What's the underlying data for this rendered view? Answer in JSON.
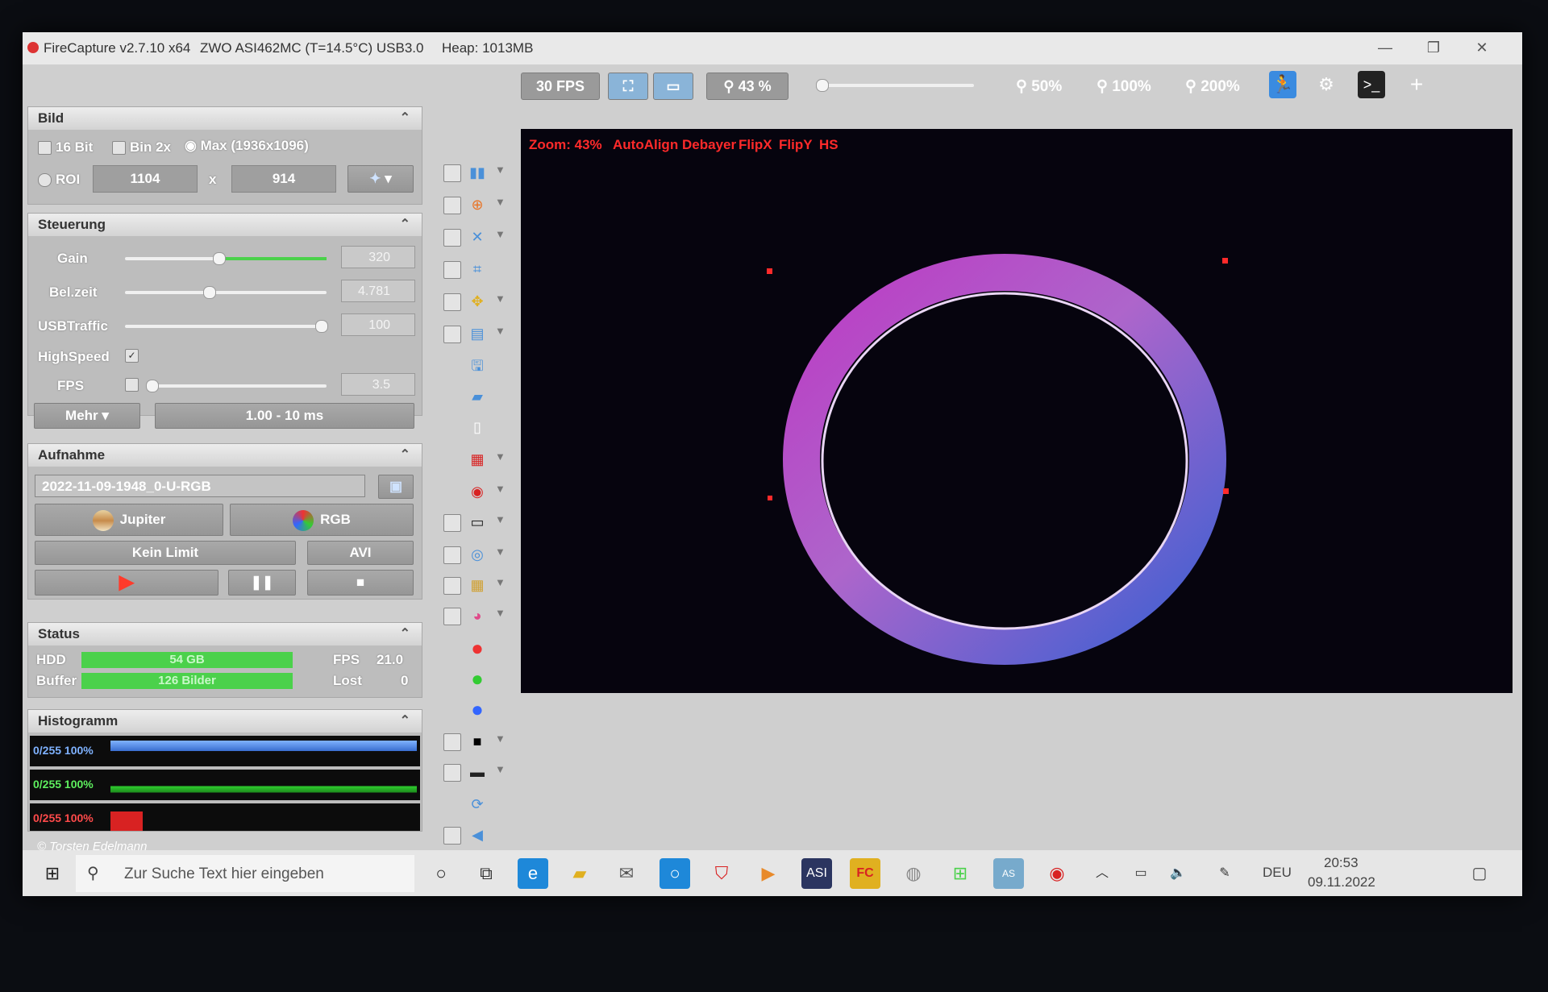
{
  "window": {
    "title": "FireCapture v2.7.10 x64",
    "camera": "ZWO ASI462MC (T=14.5°C) USB3.0",
    "heap": "Heap: 1013MB"
  },
  "toolbar": {
    "fps_button": "30 FPS",
    "zoom_level": "43 %",
    "zoom50": "50%",
    "zoom100": "100%",
    "zoom200": "200%",
    "plus": "+"
  },
  "bild": {
    "header": "Bild",
    "bit16": "16 Bit",
    "bin2x": "Bin 2x",
    "max": "Max (1936x1096)",
    "roi": "ROI",
    "roi_w": "1104",
    "x": "x",
    "roi_h": "914"
  },
  "steuerung": {
    "header": "Steuerung",
    "gain_label": "Gain",
    "gain_value": "320",
    "gain_fraction": 0.46,
    "belzeit_label": "Bel.zeit",
    "belzeit_value": "4.781",
    "belzeit_fraction": 0.41,
    "usb_label": "USBTraffic",
    "usb_value": "100",
    "usb_fraction": 1.0,
    "highspeed_label": "HighSpeed",
    "fps_label": "FPS",
    "fps_value": "3.5",
    "mehr": "Mehr",
    "range": "1.00 - 10 ms"
  },
  "aufnahme": {
    "header": "Aufnahme",
    "filename": "2022-11-09-1948_0-U-RGB",
    "jupiter": "Jupiter",
    "rgb": "RGB",
    "limit": "Kein Limit",
    "format": "AVI"
  },
  "status": {
    "header": "Status",
    "hdd_label": "HDD",
    "hdd_value": "54 GB",
    "buffer_label": "Buffer",
    "buffer_value": "126 Bilder",
    "fps_label": "FPS",
    "fps_value": "21.0",
    "lost_label": "Lost",
    "lost_value": "0"
  },
  "histogramm": {
    "header": "Histogramm",
    "blue": "0/255 100%",
    "green": "0/255 100%",
    "red": "0/255 100%"
  },
  "credit": "© Torsten Edelmann",
  "overlay": {
    "zoom": "Zoom: 43%",
    "autoalign": "AutoAlign",
    "debayer": "Debayer",
    "flipx": "FlipX",
    "flipy": "FlipY",
    "hs": "HS"
  },
  "taskbar": {
    "search_placeholder": "Zur Suche Text hier eingeben",
    "lang": "DEU",
    "time": "20:53",
    "date": "09.11.2022"
  },
  "colors": {
    "accent_green": "#4bd14b",
    "overlay_red": "#ff2a2a",
    "panel_gray": "#bdbdbd"
  }
}
